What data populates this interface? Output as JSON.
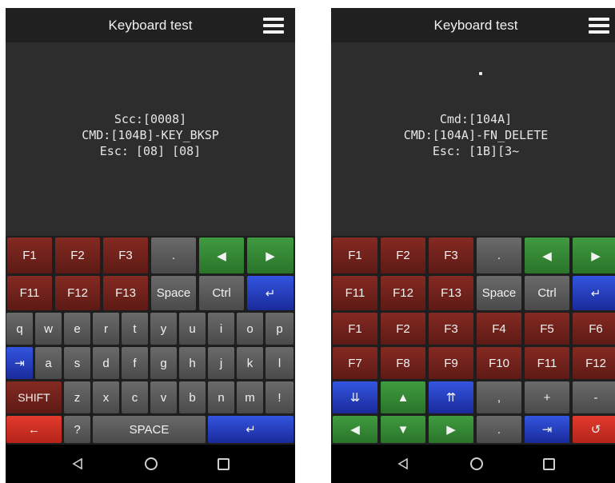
{
  "left": {
    "title": "Keyboard test",
    "output": [
      "Scc:[0008]",
      "CMD:[104B]-KEY_BKSP",
      "Esc: [08] [08]"
    ]
  },
  "right": {
    "title": "Keyboard test",
    "output": [
      "Cmd:[104A]",
      "CMD:[104A]-FN_DELETE",
      "Esc: [1B][3~"
    ]
  },
  "keys": {
    "f1": "F1",
    "f2": "F2",
    "f3": "F3",
    "f4": "F4",
    "f5": "F5",
    "f6": "F6",
    "f7": "F7",
    "f8": "F8",
    "f9": "F9",
    "f10": "F10",
    "f11": "F11",
    "f12": "F12",
    "f13": "F13",
    "dot": ".",
    "space_small": "Space",
    "ctrl": "Ctrl",
    "enter": "↵",
    "left": "◀",
    "right": "▶",
    "up": "▲",
    "down": "▼",
    "pgdn": "⇊",
    "pgup": "⇈",
    "tab": "⇥",
    "comma": ",",
    "plus": "+",
    "minus": "-",
    "undo": "↺",
    "backspace": "←",
    "shift": "SHIFT",
    "space_big": "SPACE",
    "question": "?",
    "exclaim": "!",
    "letters_row1": [
      "q",
      "w",
      "e",
      "r",
      "t",
      "y",
      "u",
      "i",
      "o",
      "p"
    ],
    "letters_row2": [
      "a",
      "s",
      "d",
      "f",
      "g",
      "h",
      "j",
      "k",
      "l"
    ],
    "letters_row3": [
      "z",
      "x",
      "c",
      "v",
      "b",
      "n",
      "m"
    ]
  },
  "icons": {
    "menu": "menu-icon",
    "back": "back-triangle-icon",
    "home": "home-circle-icon",
    "recents": "recents-square-icon"
  }
}
